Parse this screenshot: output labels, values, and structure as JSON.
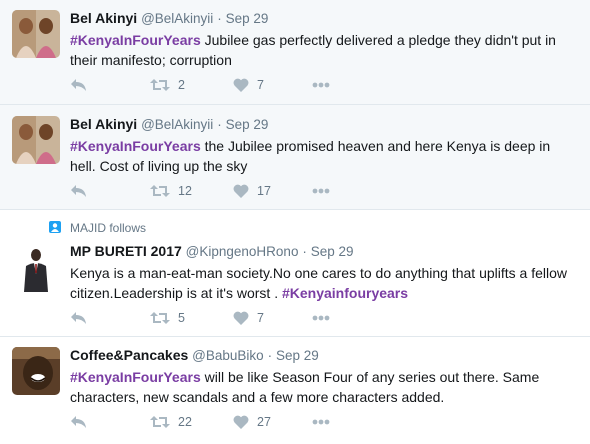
{
  "tweets": [
    {
      "name": "Bel Akinyi",
      "handle": "@BelAkinyii",
      "sep": "·",
      "time": "Sep 29",
      "hashtag": "#KenyaInFourYears",
      "text_after": " Jubilee gas perfectly delivered a pledge they didn't put in their manifesto; corruption",
      "retweets": "2",
      "likes": "7"
    },
    {
      "name": "Bel Akinyi",
      "handle": "@BelAkinyii",
      "sep": "·",
      "time": "Sep 29",
      "hashtag": "#KenyaInFourYears",
      "text_after": " the Jubilee promised heaven and here Kenya is deep in hell. Cost of living up the sky",
      "retweets": "12",
      "likes": "17"
    },
    {
      "context": "MAJID follows",
      "name": "MP BURETI 2017",
      "handle": "@KipngenoHRono",
      "sep": "·",
      "time": "Sep 29",
      "text_before": "Kenya is a man-eat-man society.No one cares to do anything that uplifts a fellow citizen.Leadership is at it's worst . ",
      "hashtag": "#Kenyainfouryears",
      "retweets": "5",
      "likes": "7"
    },
    {
      "name": "Coffee&Pancakes",
      "handle": "@BabuBiko",
      "sep": "·",
      "time": "Sep 29",
      "hashtag": "#KenyaInFourYears",
      "text_after": " will be like Season Four of any series out there. Same characters, new scandals and a few more characters added.",
      "retweets": "22",
      "likes": "27"
    }
  ],
  "colors": {
    "hashtag": "#7a3da3",
    "meta": "#657786",
    "icon": "#aab8c2",
    "shaded_bg": "#f5f8fa",
    "divider": "#e1e8ed"
  },
  "icons": [
    "reply-icon",
    "retweet-icon",
    "like-icon",
    "more-icon",
    "follow-icon"
  ]
}
